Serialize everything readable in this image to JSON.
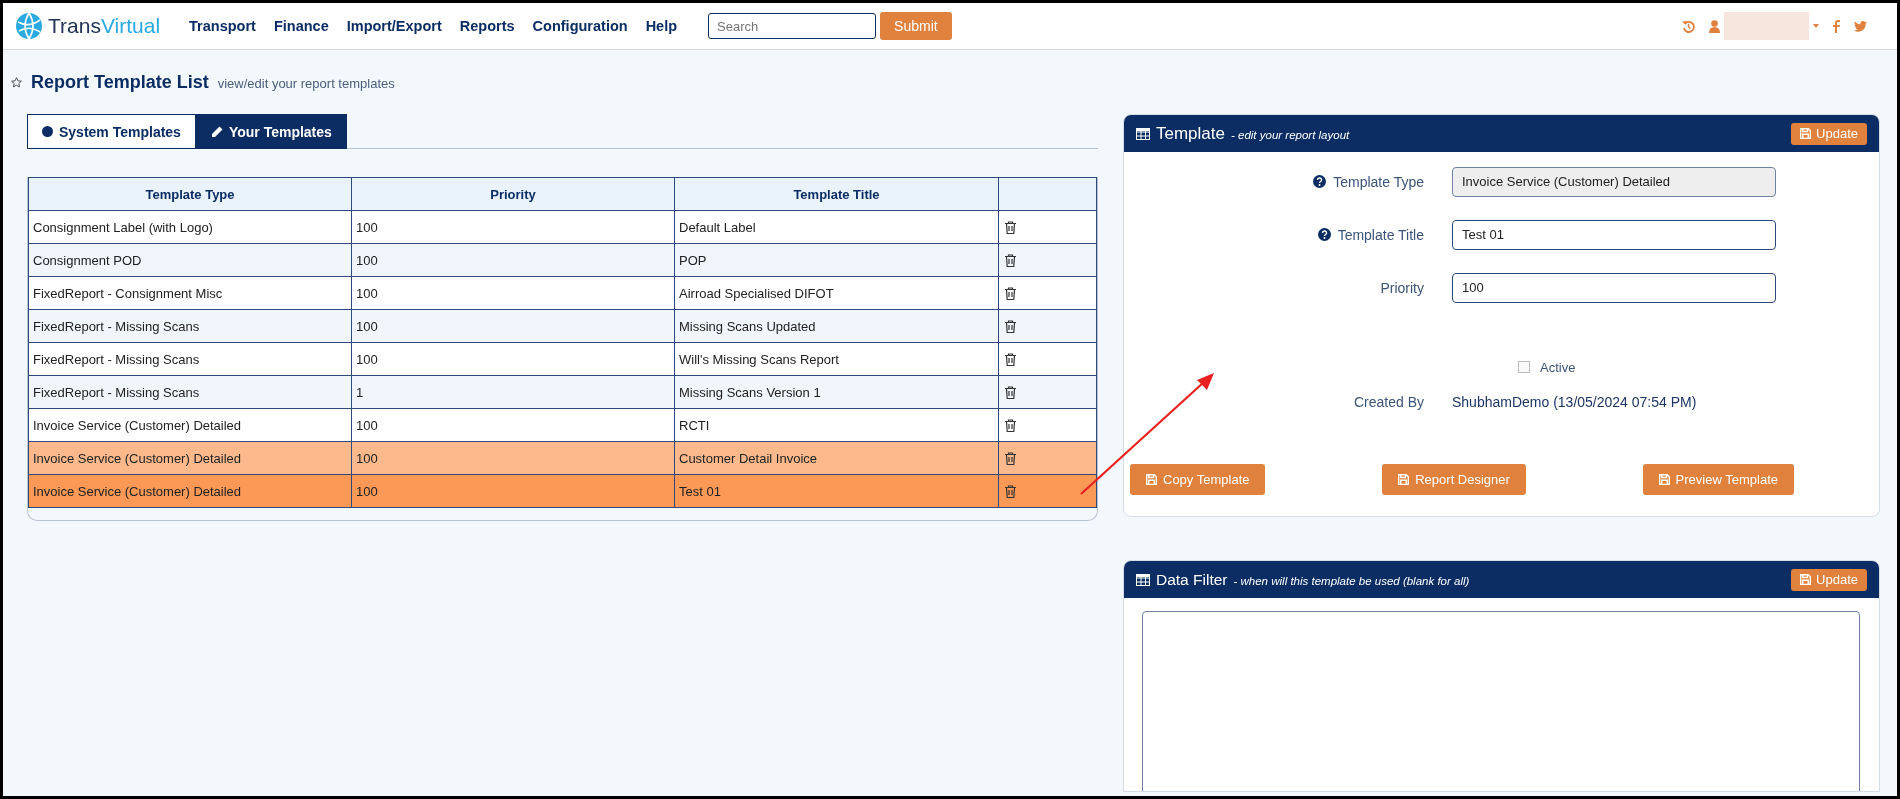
{
  "header": {
    "logo": {
      "first": "Trans",
      "second": "Virtual"
    },
    "nav": [
      "Transport",
      "Finance",
      "Import/Export",
      "Reports",
      "Configuration",
      "Help"
    ],
    "search": {
      "placeholder": "Search"
    },
    "submit": "Submit"
  },
  "page": {
    "title": "Report Template List",
    "subtitle": "view/edit your report templates"
  },
  "tabs": [
    {
      "label": "System Templates",
      "selected": false
    },
    {
      "label": "Your Templates",
      "selected": true
    }
  ],
  "table": {
    "columns": [
      "Template Type",
      "Priority",
      "Template Title"
    ],
    "rows": [
      {
        "type": "Consignment Label (with Logo)",
        "priority": "100",
        "title": "Default Label",
        "hovered": false,
        "selected": false
      },
      {
        "type": "Consignment POD",
        "priority": "100",
        "title": "POP",
        "hovered": false,
        "selected": false
      },
      {
        "type": "FixedReport - Consignment Misc",
        "priority": "100",
        "title": "Airroad Specialised DIFOT",
        "hovered": false,
        "selected": false
      },
      {
        "type": "FixedReport - Missing Scans",
        "priority": "100",
        "title": "Missing Scans Updated",
        "hovered": false,
        "selected": false
      },
      {
        "type": "FixedReport - Missing Scans",
        "priority": "100",
        "title": "Will's Missing Scans Report",
        "hovered": false,
        "selected": false
      },
      {
        "type": "FixedReport - Missing Scans",
        "priority": "1",
        "title": "Missing Scans Version 1",
        "hovered": false,
        "selected": false
      },
      {
        "type": "Invoice Service (Customer) Detailed",
        "priority": "100",
        "title": "RCTI",
        "hovered": false,
        "selected": false
      },
      {
        "type": "Invoice Service (Customer) Detailed",
        "priority": "100",
        "title": "Customer Detail Invoice",
        "hovered": true,
        "selected": false
      },
      {
        "type": "Invoice Service (Customer) Detailed",
        "priority": "100",
        "title": "Test 01",
        "hovered": false,
        "selected": true
      }
    ]
  },
  "template_panel": {
    "title": "Template",
    "subtitle": "- edit your report layout",
    "update": "Update",
    "fields": [
      {
        "label": "Template Type",
        "value": "Invoice Service (Customer) Detailed",
        "help": true,
        "readonly": true
      },
      {
        "label": "Template Title",
        "value": "Test 01",
        "help": true,
        "readonly": false
      },
      {
        "label": "Priority",
        "value": "100",
        "help": false,
        "readonly": false
      }
    ],
    "active": {
      "label": "Active",
      "checked": false
    },
    "created_by": {
      "label": "Created By",
      "value": "ShubhamDemo (13/05/2024 07:54 PM)"
    },
    "buttons": [
      "Copy Template",
      "Report Designer",
      "Preview Template"
    ]
  },
  "filter_panel": {
    "title": "Data Filter",
    "subtitle": "- when will this template be used (blank for all)",
    "update": "Update"
  }
}
